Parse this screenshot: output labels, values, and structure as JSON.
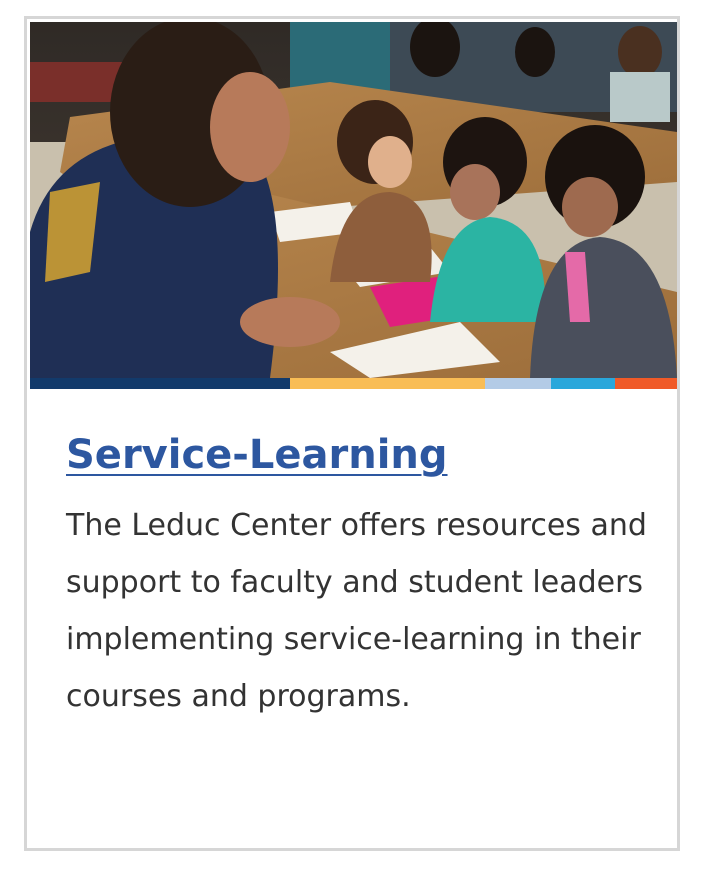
{
  "card": {
    "image": {
      "alt_icon": "photo-classroom-icon",
      "description_hidden": ""
    },
    "color_bar": {
      "colors": [
        "#123a6b",
        "#f9bd55",
        "#b3cbe6",
        "#29a7db",
        "#f05a28"
      ]
    },
    "title": "Service-Learning",
    "description": "The Leduc Center offers resources and support to faculty and student leaders implementing service-learning in their courses and programs."
  },
  "colors": {
    "link": "#2d57a0",
    "text": "#333333",
    "border": "#d6d6d6"
  }
}
